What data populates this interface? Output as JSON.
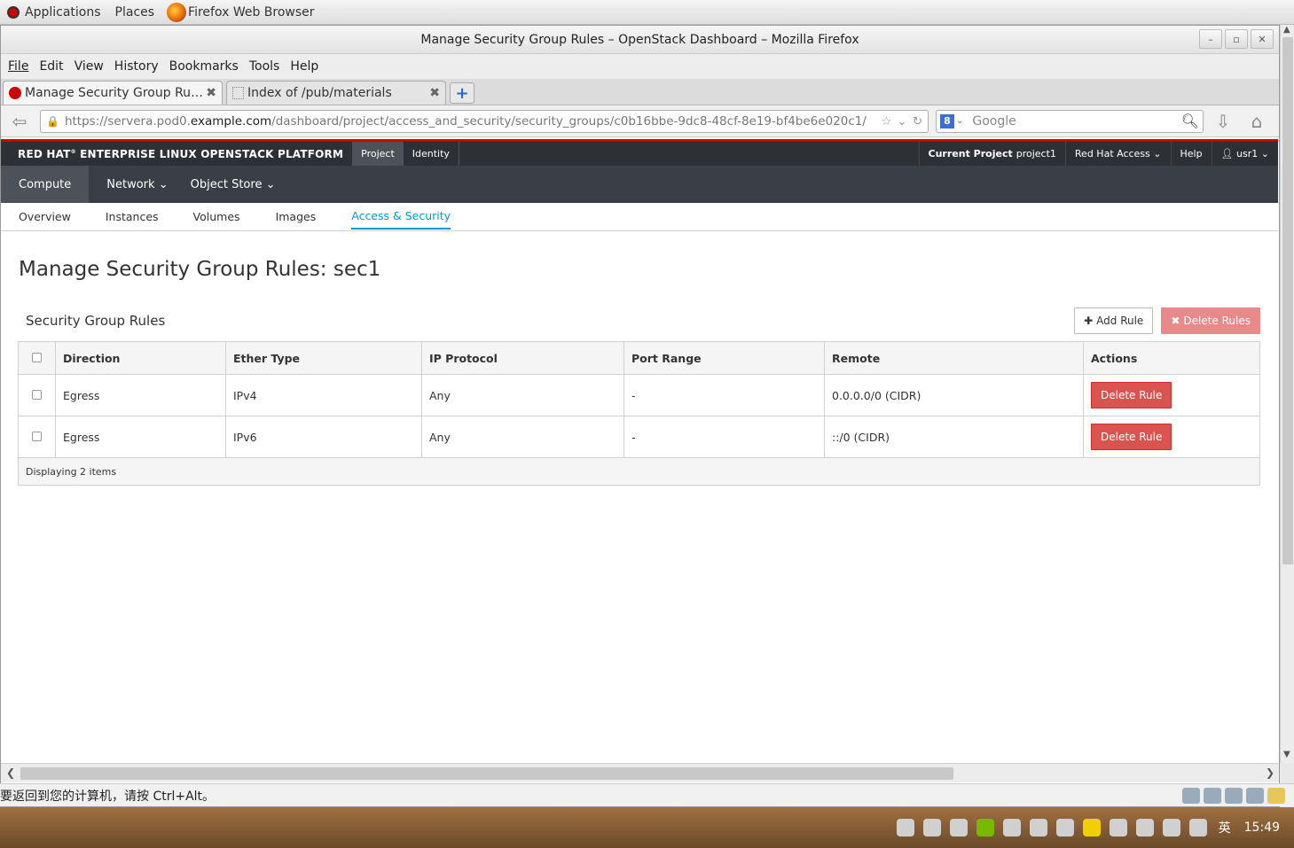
{
  "gnome": {
    "applications": "Applications",
    "places": "Places",
    "browser_task": "Firefox Web Browser"
  },
  "window": {
    "title": "Manage Security Group Rules – OpenStack Dashboard – Mozilla Firefox",
    "min": "–",
    "max": "▫",
    "close": "✕"
  },
  "menu": {
    "file": "File",
    "edit": "Edit",
    "view": "View",
    "history": "History",
    "bookmarks": "Bookmarks",
    "tools": "Tools",
    "help": "Help"
  },
  "tabs": [
    {
      "label": "Manage Security Group Rule…",
      "close": "✖"
    },
    {
      "label": "Index of /pub/materials",
      "close": "✖"
    }
  ],
  "new_tab": "+",
  "address": {
    "prefix": "https://servera.pod0.",
    "domain": "example.com",
    "path": "/dashboard/project/access_and_security/security_groups/c0b16bbe-9dc8-48cf-8e19-bf4be6e020c1/"
  },
  "search": {
    "engine": "8",
    "placeholder": "Google"
  },
  "dashboard": {
    "brand": "RED HAT",
    "brand_sup": "®",
    "brand_rest": " ENTERPRISE LINUX OPENSTACK PLATFORM",
    "top_nav": [
      "Project",
      "Identity"
    ],
    "current_project_label": "Current Project",
    "current_project": "project1",
    "redhat_access": "Red Hat Access",
    "help": "Help",
    "user": "usr1",
    "sec_nav": [
      "Compute",
      "Network",
      "Object Store"
    ],
    "sub_nav": [
      "Overview",
      "Instances",
      "Volumes",
      "Images",
      "Access & Security"
    ]
  },
  "page": {
    "title": "Manage Security Group Rules: sec1",
    "table_caption": "Security Group Rules",
    "add_rule": "Add Rule",
    "delete_rules": "Delete Rules",
    "columns": [
      "Direction",
      "Ether Type",
      "IP Protocol",
      "Port Range",
      "Remote",
      "Actions"
    ],
    "rows": [
      {
        "direction": "Egress",
        "ether": "IPv4",
        "protocol": "Any",
        "port": "-",
        "remote": "0.0.0.0/0 (CIDR)",
        "action": "Delete Rule"
      },
      {
        "direction": "Egress",
        "ether": "IPv6",
        "protocol": "Any",
        "port": "-",
        "remote": "::/0 (CIDR)",
        "action": "Delete Rule"
      }
    ],
    "footer": "Displaying 2 items"
  },
  "status_message": "要返回到您的计算机，请按 Ctrl+Alt。",
  "taskbar": {
    "ime": "英",
    "clock": "15:49"
  },
  "colors": {
    "accent": "#0099d3",
    "danger": "#d9534f",
    "brand_red": "#cc0000",
    "header_dark": "#2d3136"
  }
}
